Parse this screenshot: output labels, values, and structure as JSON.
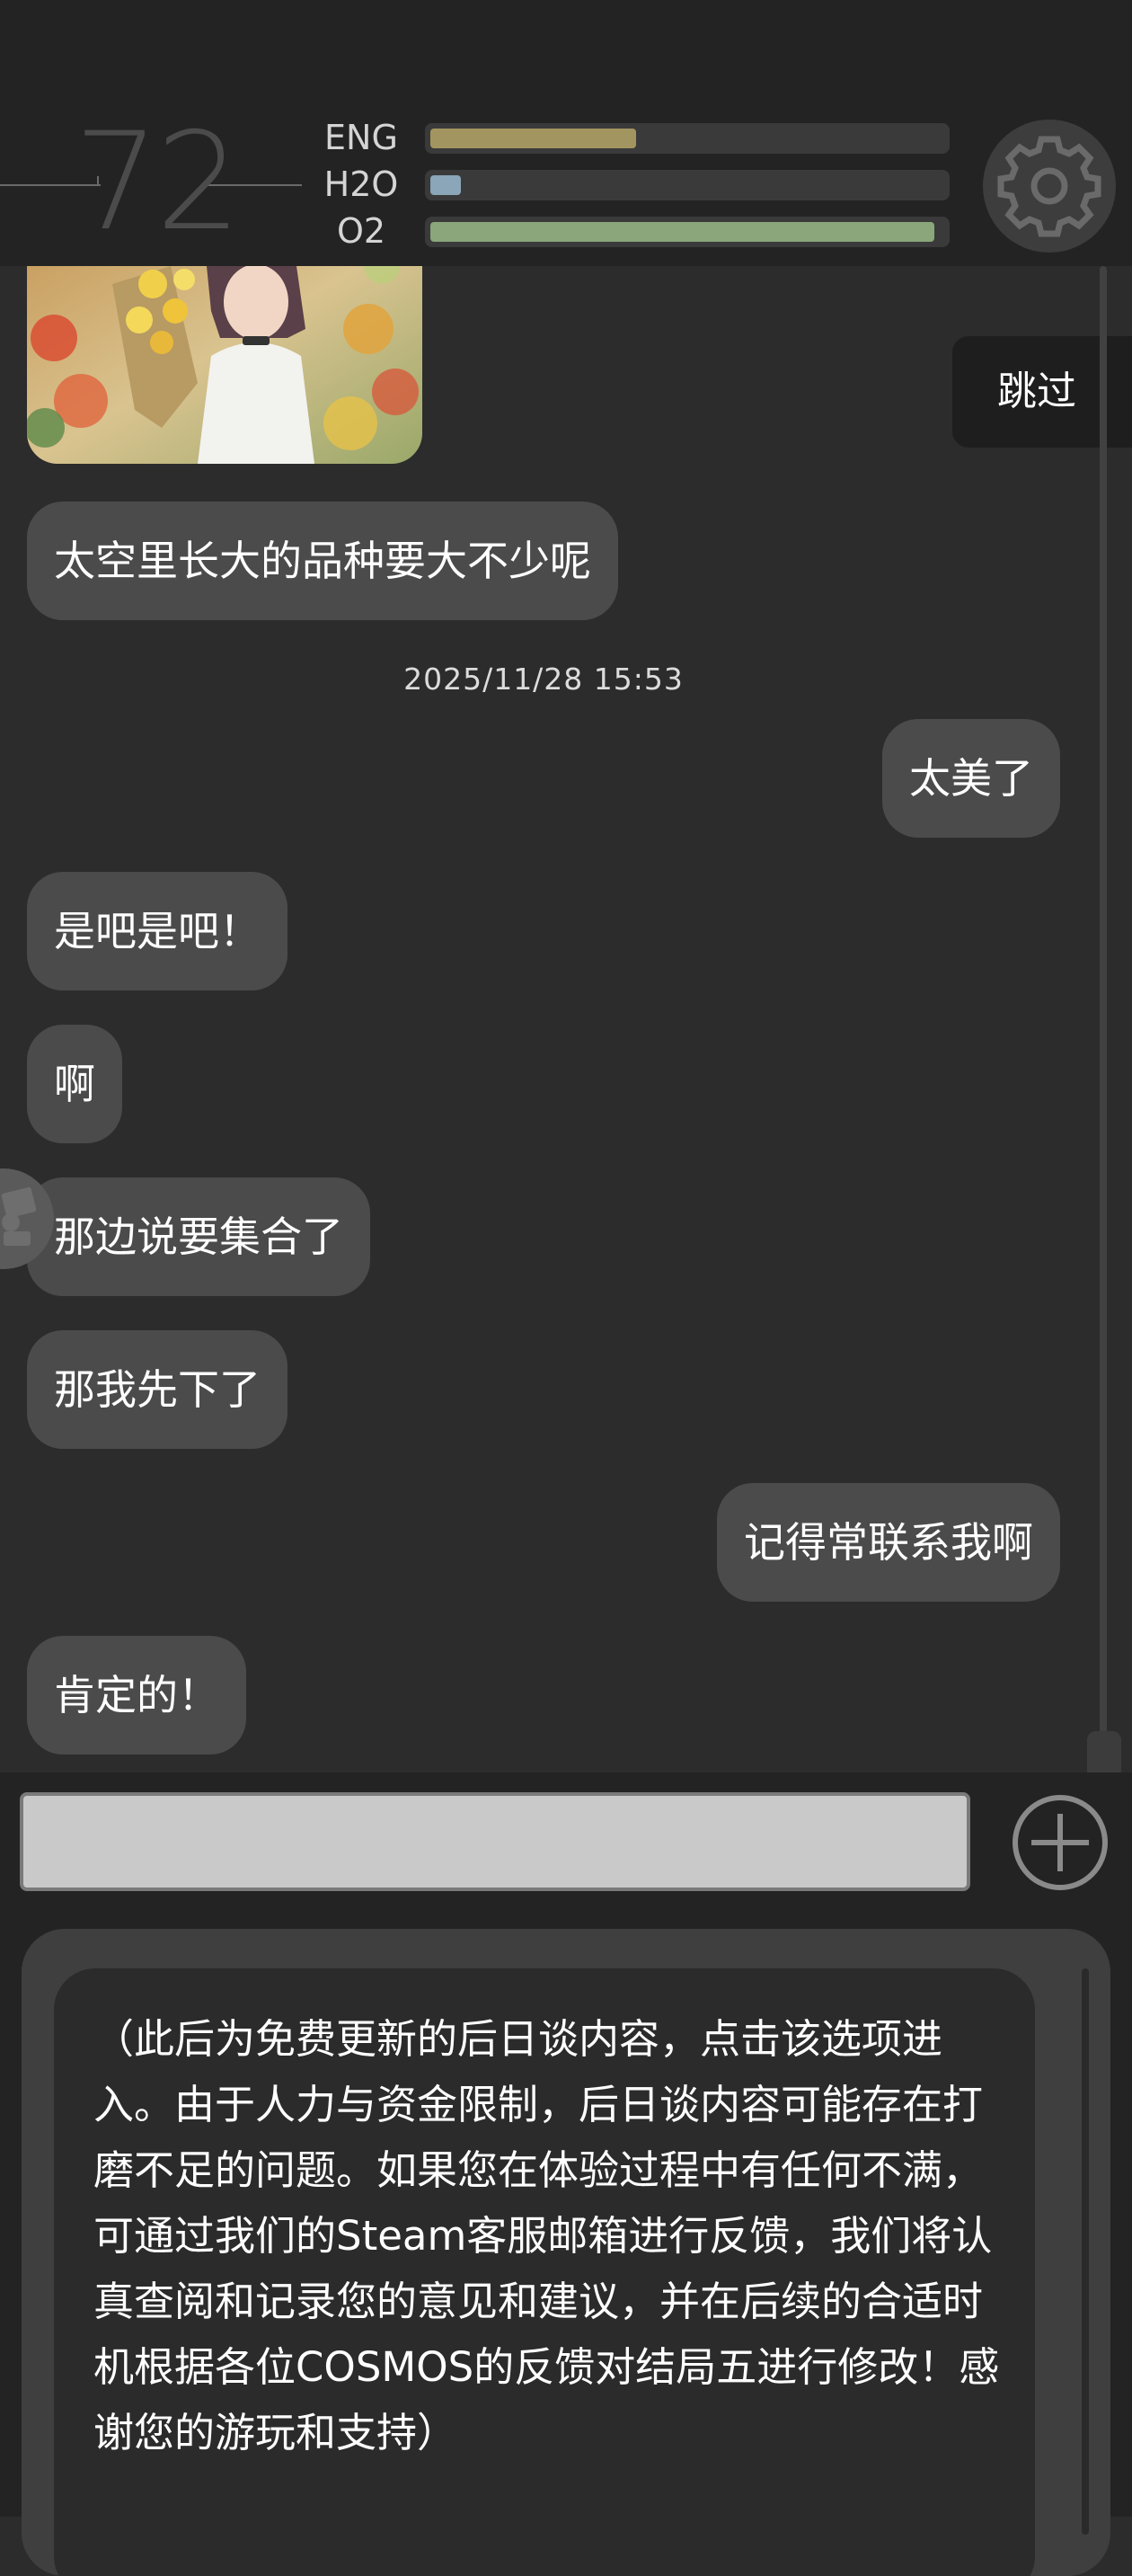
{
  "hud": {
    "level": "72",
    "stats": [
      {
        "label": "ENG",
        "value": 0.4,
        "color": "#a39560"
      },
      {
        "label": "H2O",
        "value": 0.06,
        "color": "#8aa6b8"
      },
      {
        "label": "O2",
        "value": 0.98,
        "color": "#8aa67a"
      }
    ],
    "settings_icon": "gear-icon"
  },
  "chat": {
    "skip_label": "跳过",
    "messages": [
      {
        "side": "left",
        "text": "太空里长大的品种要大不少呢"
      },
      {
        "timestamp": "2025/11/28  15:53"
      },
      {
        "side": "right",
        "text": "太美了"
      },
      {
        "side": "left",
        "text": "是吧是吧！"
      },
      {
        "side": "left",
        "text": "啊"
      },
      {
        "side": "left",
        "text": "那边说要集合了"
      },
      {
        "side": "left",
        "text": "那我先下了"
      },
      {
        "side": "right",
        "text": "记得常联系我啊"
      },
      {
        "side": "left",
        "text": "肯定的！"
      }
    ]
  },
  "input": {
    "value": "",
    "placeholder": "",
    "add_icon": "plus-circle-icon"
  },
  "option": {
    "text": "（此后为免费更新的后日谈内容，点击该选项进入。由于人力与资金限制，后日谈内容可能存在打磨不足的问题。如果您在体验过程中有任何不满，可通过我们的Steam客服邮箱进行反馈，我们将认真查阅和记录您的意见和建议，并在后续的合适时机根据各位COSMOS的反馈对结局五进行修改！感谢您的游玩和支持）"
  }
}
